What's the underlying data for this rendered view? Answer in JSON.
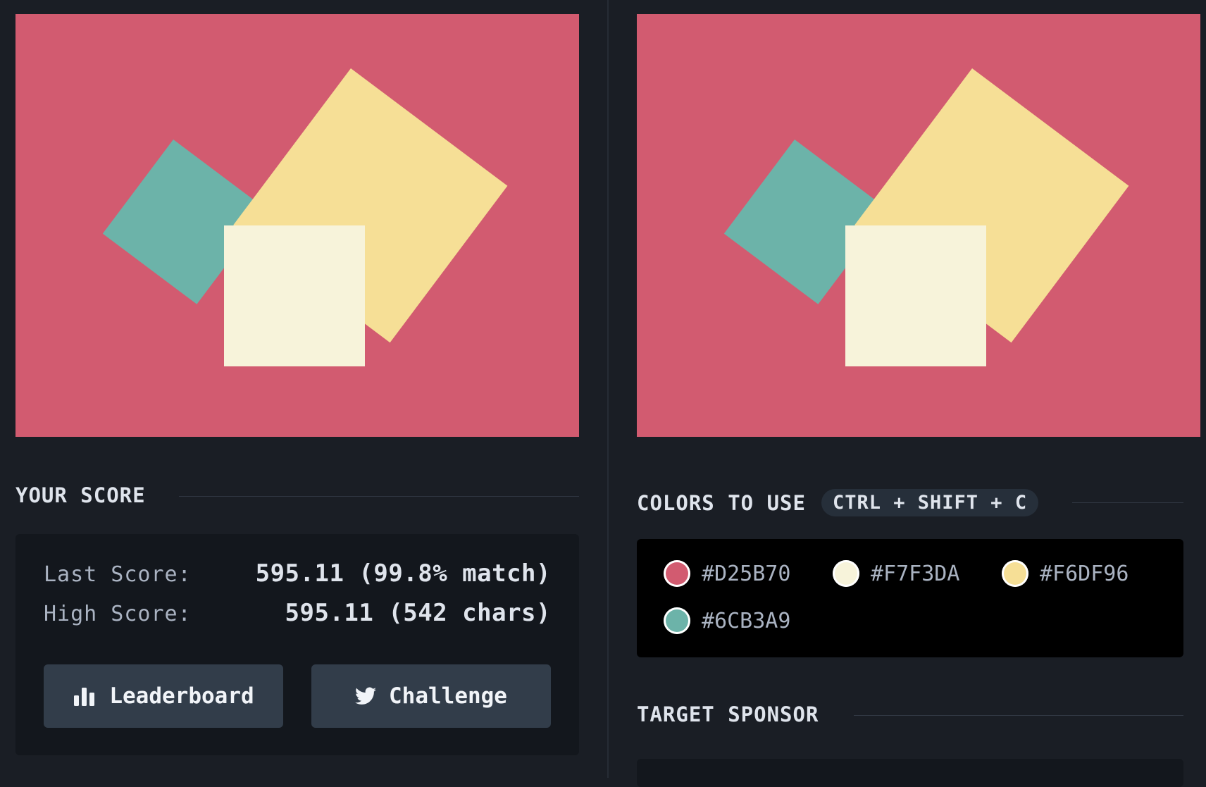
{
  "colors": {
    "background": "#D25B70",
    "cream": "#F7F3DA",
    "yellow": "#F6DF96",
    "teal": "#6CB3A9"
  },
  "score": {
    "heading": "YOUR SCORE",
    "last_label": "Last Score:",
    "last_value": "595.11 (99.8% match)",
    "high_label": "High Score:",
    "high_value": "595.11 (542 chars)",
    "leaderboard_label": "Leaderboard",
    "leaderboard_icon": "bar-chart-icon",
    "challenge_label": "Challenge",
    "challenge_icon": "twitter-icon"
  },
  "palette": {
    "heading": "COLORS TO USE",
    "shortcut": "CTRL + SHIFT + C",
    "items": [
      {
        "hex": "#D25B70"
      },
      {
        "hex": "#F7F3DA"
      },
      {
        "hex": "#F6DF96"
      },
      {
        "hex": "#6CB3A9"
      }
    ]
  },
  "sponsor": {
    "heading": "TARGET SPONSOR"
  }
}
